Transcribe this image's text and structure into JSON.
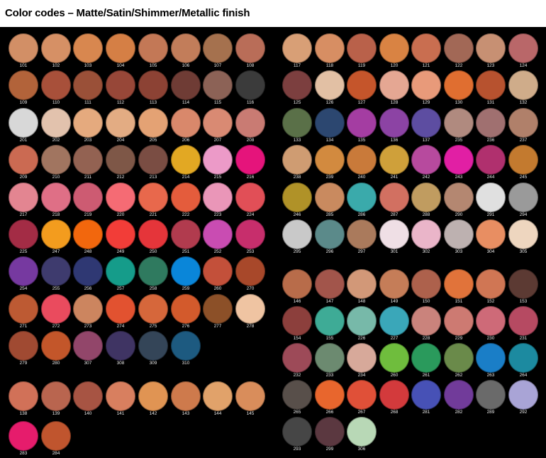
{
  "title": "Color codes – Matte/Satin/Shimmer/Metallic finish",
  "colors": {
    "background": "#000000",
    "label": "#e6e6e6"
  },
  "groups": [
    {
      "name": "left-main",
      "rows": [
        [
          [
            "101",
            "#d28f66"
          ],
          [
            "102",
            "#d69065"
          ],
          [
            "103",
            "#d8874f"
          ],
          [
            "104",
            "#d57f45"
          ],
          [
            "105",
            "#c37856"
          ],
          [
            "106",
            "#c27d5a"
          ],
          [
            "107",
            "#a5714e"
          ],
          [
            "108",
            "#b96d58"
          ]
        ],
        [
          [
            "109",
            "#b2633a"
          ],
          [
            "110",
            "#a8503a"
          ],
          [
            "111",
            "#9a5038"
          ],
          [
            "112",
            "#974738"
          ],
          [
            "113",
            "#8c4234"
          ],
          [
            "114",
            "#6f3c35"
          ],
          [
            "115",
            "#8c6256"
          ],
          [
            "116",
            "#3b3b3b"
          ]
        ],
        [
          [
            "201",
            "#d8d8d8"
          ],
          [
            "202",
            "#e2c2ad"
          ],
          [
            "203",
            "#e5aa7e"
          ],
          [
            "204",
            "#e3ac83"
          ],
          [
            "205",
            "#e4a274"
          ],
          [
            "206",
            "#d9886b"
          ],
          [
            "207",
            "#d98a73"
          ],
          [
            "208",
            "#c97b73"
          ]
        ],
        [
          [
            "209",
            "#cb6a52"
          ],
          [
            "210",
            "#a17560"
          ],
          [
            "211",
            "#936252"
          ],
          [
            "212",
            "#7e5747"
          ],
          [
            "213",
            "#7a4d43"
          ],
          [
            "214",
            "#e2a823"
          ],
          [
            "215",
            "#ec9ac8"
          ],
          [
            "216",
            "#e5147b"
          ]
        ],
        [
          [
            "217",
            "#e38591"
          ],
          [
            "218",
            "#df6f86"
          ],
          [
            "219",
            "#cd5b72"
          ],
          [
            "220",
            "#f56b74"
          ],
          [
            "221",
            "#e8684c"
          ],
          [
            "222",
            "#e45c3c"
          ],
          [
            "223",
            "#ea96b8"
          ],
          [
            "224",
            "#e14f57"
          ]
        ],
        [
          [
            "225",
            "#a32c45"
          ],
          [
            "247",
            "#f39c1e"
          ],
          [
            "248",
            "#f2670d"
          ],
          [
            "249",
            "#f23d38"
          ],
          [
            "250",
            "#e5353a"
          ],
          [
            "251",
            "#b13b4e"
          ],
          [
            "252",
            "#c94cb2"
          ],
          [
            "253",
            "#c72e6c"
          ]
        ],
        [
          [
            "254",
            "#7639a0"
          ],
          [
            "255",
            "#3e3b6e"
          ],
          [
            "256",
            "#2f3873"
          ],
          [
            "257",
            "#159c8a"
          ],
          [
            "258",
            "#2f7a5f"
          ],
          [
            "259",
            "#0a86d9"
          ],
          [
            "260",
            "#c3503a"
          ],
          [
            "270",
            "#a8482a"
          ]
        ],
        [
          [
            "271",
            "#bd5a33"
          ],
          [
            "272",
            "#ea4b5e"
          ],
          [
            "273",
            "#cc855f"
          ],
          [
            "274",
            "#e25230"
          ],
          [
            "275",
            "#d6673b"
          ],
          [
            "276",
            "#d35a2c"
          ],
          [
            "277",
            "#8c5028"
          ],
          [
            "278",
            "#efc4a2"
          ]
        ],
        [
          [
            "279",
            "#a04a32"
          ],
          [
            "280",
            "#c3562a"
          ],
          [
            "307",
            "#92466a"
          ],
          [
            "308",
            "#3f3463"
          ],
          [
            "309",
            "#344558"
          ],
          [
            "310",
            "#1d5a80"
          ]
        ]
      ]
    },
    {
      "name": "left-bottom",
      "rows": [
        [
          [
            "138",
            "#d17158"
          ],
          [
            "139",
            "#b9654f"
          ],
          [
            "140",
            "#a75443"
          ],
          [
            "141",
            "#d87f5f"
          ],
          [
            "142",
            "#e09453"
          ],
          [
            "143",
            "#ce7a4c"
          ],
          [
            "144",
            "#e1a26a"
          ],
          [
            "145",
            "#d98d5b"
          ]
        ],
        [
          [
            "283",
            "#e61c6c"
          ],
          [
            "284",
            "#c0552e"
          ]
        ]
      ]
    },
    {
      "name": "right-top",
      "rows": [
        [
          [
            "117",
            "#d89f76"
          ],
          [
            "118",
            "#d78e63"
          ],
          [
            "119",
            "#b9614a"
          ],
          [
            "120",
            "#d98343"
          ],
          [
            "121",
            "#c96e50"
          ],
          [
            "122",
            "#a26856"
          ],
          [
            "123",
            "#c79073"
          ],
          [
            "124",
            "#b96769"
          ]
        ],
        [
          [
            "125",
            "#7c3f3f"
          ],
          [
            "126",
            "#e2c0a4"
          ],
          [
            "127",
            "#c5552b"
          ],
          [
            "128",
            "#e5a793"
          ],
          [
            "129",
            "#e89a7a"
          ],
          [
            "130",
            "#e06e30"
          ],
          [
            "131",
            "#b7522f"
          ],
          [
            "132",
            "#cfac8a"
          ]
        ],
        [
          [
            "133",
            "#5a7048"
          ],
          [
            "134",
            "#2c4770"
          ],
          [
            "135",
            "#a43da2"
          ],
          [
            "136",
            "#8c43a4"
          ],
          [
            "137",
            "#5d4da1"
          ],
          [
            "235",
            "#b08a7f"
          ],
          [
            "236",
            "#a07070"
          ],
          [
            "237",
            "#b0806a"
          ]
        ],
        [
          [
            "238",
            "#cf9c72"
          ],
          [
            "239",
            "#d28a3f"
          ],
          [
            "240",
            "#c97a3a"
          ],
          [
            "241",
            "#cfa03a"
          ],
          [
            "242",
            "#b74a9e"
          ],
          [
            "243",
            "#e11fa4"
          ],
          [
            "244",
            "#b0306e"
          ],
          [
            "245",
            "#c37a2f"
          ]
        ],
        [
          [
            "246",
            "#b09228"
          ],
          [
            "285",
            "#c98a5f"
          ],
          [
            "286",
            "#3aaaab"
          ],
          [
            "287",
            "#d27061"
          ],
          [
            "288",
            "#c09c60"
          ],
          [
            "290",
            "#b48771"
          ],
          [
            "291",
            "#e0e0e0"
          ],
          [
            "294",
            "#9a9a9a"
          ]
        ],
        [
          [
            "295",
            "#c9c9c9"
          ],
          [
            "296",
            "#5b8a8a"
          ],
          [
            "297",
            "#aa7a5c"
          ],
          [
            "301",
            "#efdfe5"
          ],
          [
            "302",
            "#eab5c9"
          ],
          [
            "303",
            "#bdb1b0"
          ],
          [
            "304",
            "#e88e62"
          ],
          [
            "305",
            "#eed6bf"
          ]
        ]
      ]
    },
    {
      "name": "right-bottom",
      "rows": [
        [
          [
            "146",
            "#b86c4a"
          ],
          [
            "147",
            "#a2554b"
          ],
          [
            "148",
            "#d29878"
          ],
          [
            "149",
            "#c57d58"
          ],
          [
            "150",
            "#ad614c"
          ],
          [
            "151",
            "#e1733a"
          ],
          [
            "152",
            "#d07654"
          ],
          [
            "153",
            "#5c3a33"
          ]
        ],
        [
          [
            "154",
            "#8c3f3c"
          ],
          [
            "155",
            "#3eab96"
          ],
          [
            "226",
            "#77b9a9"
          ],
          [
            "227",
            "#3aa7b9"
          ],
          [
            "228",
            "#ca837c"
          ],
          [
            "229",
            "#cd7a72"
          ],
          [
            "230",
            "#ce6a78"
          ],
          [
            "231",
            "#b64a62"
          ]
        ],
        [
          [
            "232",
            "#9d4a58"
          ],
          [
            "233",
            "#6c8a70"
          ],
          [
            "234",
            "#d7a99a"
          ],
          [
            "260",
            "#6fbd3d"
          ],
          [
            "261",
            "#2a9a5c"
          ],
          [
            "262",
            "#6a8a4a"
          ],
          [
            "263",
            "#1a7ec7"
          ],
          [
            "264",
            "#1c8aa0"
          ]
        ],
        [
          [
            "265",
            "#584f4a"
          ],
          [
            "266",
            "#e8662d"
          ],
          [
            "267",
            "#e05038"
          ],
          [
            "268",
            "#d33a3c"
          ],
          [
            "281",
            "#4751b6"
          ],
          [
            "282",
            "#713b9a"
          ],
          [
            "289",
            "#6a6a6a"
          ],
          [
            "292",
            "#a9a4d6"
          ]
        ],
        [
          [
            "293",
            "#464646"
          ],
          [
            "299",
            "#5b3840"
          ],
          [
            "306",
            "#b8d8b6"
          ]
        ]
      ]
    }
  ]
}
